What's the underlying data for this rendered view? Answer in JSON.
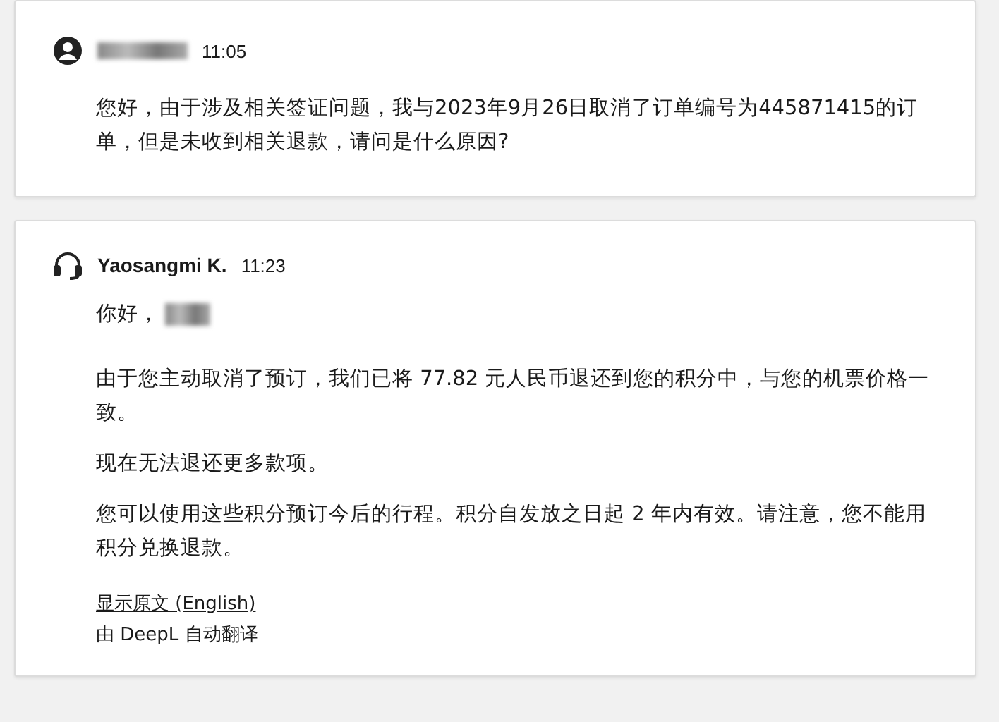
{
  "messages": [
    {
      "kind": "customer",
      "time": "11:05",
      "paragraphs": [
        "您好，由于涉及相关签证问题，我与2023年9月26日取消了订单编号为445871415的订单，但是未收到相关退款，请问是什么原因?"
      ]
    },
    {
      "kind": "agent",
      "sender": "Yaosangmi K.",
      "time": "11:23",
      "greeting": "你好，",
      "paragraphs": [
        "由于您主动取消了预订，我们已将 77.82 元人民币退还到您的积分中，与您的机票价格一致。",
        "现在无法退还更多款项。",
        "您可以使用这些积分预订今后的行程。积分自发放之日起 2 年内有效。请注意，您不能用积分兑换退款。"
      ],
      "original_link": "显示原文 (English)",
      "translation_note": "由 DeepL 自动翻译"
    }
  ]
}
